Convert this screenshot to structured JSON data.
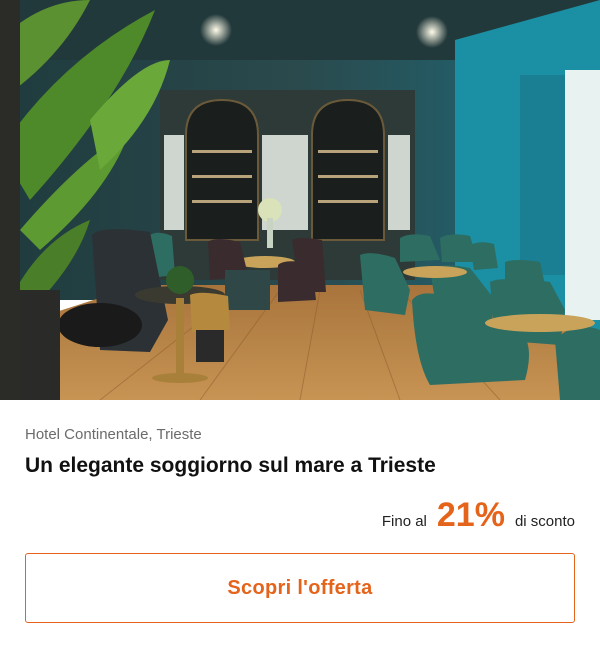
{
  "image": {
    "alt": "Hotel Continentale, Trieste"
  },
  "offer": {
    "location": "Hotel Continentale, Trieste",
    "title": "Un elegante soggiorno sul mare a Trieste",
    "discount_prefix": "Fino al",
    "discount_value": "21%",
    "discount_suffix": "di sconto",
    "cta_label": "Scopri l'offerta"
  },
  "colors": {
    "accent": "#e5641c"
  }
}
